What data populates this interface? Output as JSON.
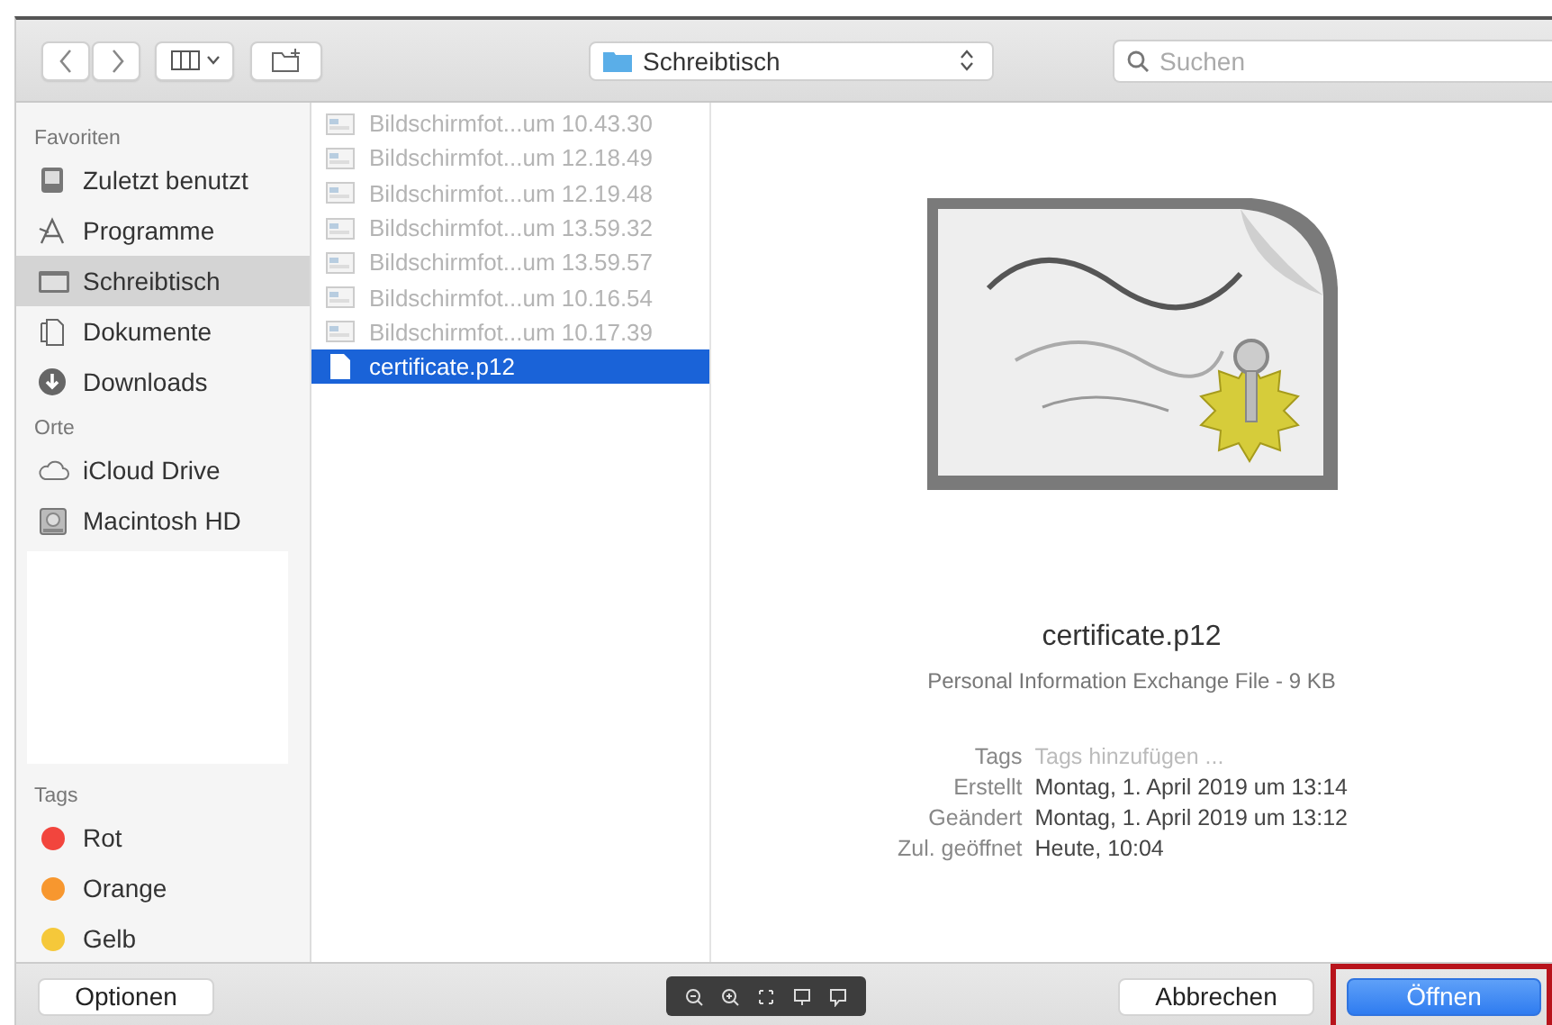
{
  "toolbar": {
    "location": "Schreibtisch",
    "search": {
      "placeholder": "Suchen"
    }
  },
  "sidebar": {
    "sections": [
      {
        "heading": "Favoriten",
        "items": [
          {
            "label": "Zuletzt benutzt",
            "kind": "recent",
            "selected": false
          },
          {
            "label": "Programme",
            "kind": "apps",
            "selected": false
          },
          {
            "label": "Schreibtisch",
            "kind": "desktop",
            "selected": true
          },
          {
            "label": "Dokumente",
            "kind": "documents",
            "selected": false
          },
          {
            "label": "Downloads",
            "kind": "downloads",
            "selected": false
          }
        ]
      },
      {
        "heading": "Orte",
        "items": [
          {
            "label": "iCloud Drive",
            "kind": "cloud",
            "selected": false
          },
          {
            "label": "Macintosh HD",
            "kind": "disk",
            "selected": false
          }
        ]
      },
      {
        "heading": "Tags",
        "items": [
          {
            "label": "Rot",
            "kind": "tag",
            "color": "#f2453d",
            "selected": false
          },
          {
            "label": "Orange",
            "kind": "tag",
            "color": "#f7972f",
            "selected": false
          },
          {
            "label": "Gelb",
            "kind": "tag",
            "color": "#f5c83a",
            "selected": false
          }
        ]
      }
    ]
  },
  "files": [
    {
      "name": "Bildschirmfot...um 10.43.30",
      "kind": "screenshot",
      "disabled": true,
      "selected": false
    },
    {
      "name": "Bildschirmfot...um 12.18.49",
      "kind": "screenshot",
      "disabled": true,
      "selected": false
    },
    {
      "name": "Bildschirmfot...um 12.19.48",
      "kind": "screenshot",
      "disabled": true,
      "selected": false
    },
    {
      "name": "Bildschirmfot...um 13.59.32",
      "kind": "screenshot",
      "disabled": true,
      "selected": false
    },
    {
      "name": "Bildschirmfot...um 13.59.57",
      "kind": "screenshot",
      "disabled": true,
      "selected": false
    },
    {
      "name": "Bildschirmfot...um 10.16.54",
      "kind": "screenshot",
      "disabled": true,
      "selected": false
    },
    {
      "name": "Bildschirmfot...um 10.17.39",
      "kind": "screenshot",
      "disabled": true,
      "selected": false
    },
    {
      "name": "certificate.p12",
      "kind": "document",
      "disabled": false,
      "selected": true
    }
  ],
  "preview": {
    "name": "certificate.p12",
    "subtitle": "Personal Information Exchange File - 9 KB",
    "info": [
      {
        "label": "Tags",
        "placeholder": "Tags hinzufügen ...",
        "kind": "field"
      },
      {
        "label": "Erstellt",
        "value": "Montag, 1. April 2019 um 13:14",
        "kind": "text"
      },
      {
        "label": "Geändert",
        "value": "Montag, 1. April 2019 um 13:12",
        "kind": "text"
      },
      {
        "label": "Zul. geöffnet",
        "value": "Heute, 10:04",
        "kind": "text"
      }
    ]
  },
  "buttons": {
    "options": "Optionen",
    "cancel": "Abbrechen",
    "open": {
      "label": "Öffnen",
      "highlighted": true
    }
  }
}
